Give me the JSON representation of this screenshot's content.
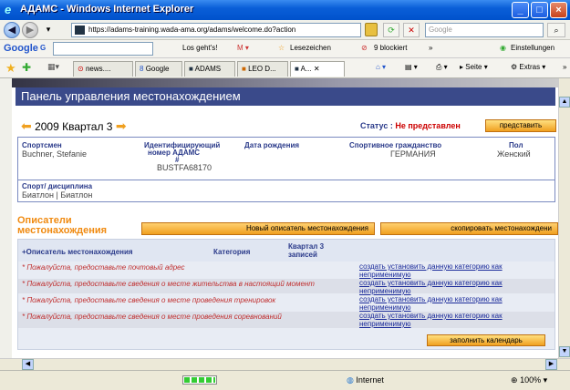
{
  "window": {
    "title": "АДАМС - Windows Internet Explorer"
  },
  "address": {
    "url": "https://adams-training.wada-ama.org/adams/welcome.do?action",
    "search_placeholder": "Google"
  },
  "google_toolbar": {
    "logo": "Google",
    "g_label": "G",
    "goto": "Los geht's!",
    "bookmarks": "Lesezeichen",
    "blocked": "9 blockiert",
    "settings": "Einstellungen"
  },
  "tabs": [
    {
      "label": "news...."
    },
    {
      "label": "Google"
    },
    {
      "label": "ADAMS"
    },
    {
      "label": "LEO D..."
    },
    {
      "label": "A..."
    }
  ],
  "tab_tools": {
    "page": "Seite",
    "extras": "Extras"
  },
  "panel": {
    "title": "Панель управления местонахождением"
  },
  "quarter": {
    "label": "2009 Квартал 3"
  },
  "status": {
    "label": "Статус :",
    "value": "Не представлен",
    "submit": "представить"
  },
  "athlete": {
    "athlete_hdr": "Спортсмен",
    "athlete_val": "Buchner, Stefanie",
    "id_hdr_1": "Идентифицирующий",
    "id_hdr_2": "номер АДАМС",
    "id_hdr_3": "#",
    "id_val": "BUSTFA68170",
    "dob_hdr": "Дата рождения",
    "citizenship_hdr": "Спортивное гражданство",
    "citizenship_val": "ГЕРМАНИЯ",
    "gender_hdr": "Пол",
    "gender_val": "Женский"
  },
  "sport": {
    "hdr": "Спорт/ дисциплина",
    "val": "Биатлон | Биатлон"
  },
  "descriptors": {
    "title_1": "Описатели",
    "title_2": "местонахождения",
    "new_btn": "Новый описатель местонахождения",
    "copy_btn": "скопировать местонахождени",
    "col_descriptor": "+Описатель местонахождения",
    "col_category": "Категория",
    "col_quarter_1": "Квартал 3",
    "col_quarter_2": "записей",
    "rows": [
      {
        "msg": "* Пожалуйста, предоставьте почтовый адрес",
        "link": "создать установить данную категорию как неприменимую"
      },
      {
        "msg": "* Пожалуйста, предоставьте сведения о месте жительства в настоящий момент",
        "link": "создать установить данную категорию как неприменимую"
      },
      {
        "msg": "* Пожалуйста, предоставьте сведения о месте проведения тренировок",
        "link": "создать установить данную категорию как неприменимую"
      },
      {
        "msg": "* Пожалуйста, предоставьте сведения о месте проведения соревнований",
        "link": "создать установить данную категорию как неприменимую"
      }
    ],
    "calendar_btn": "заполнить календарь"
  },
  "statusbar": {
    "zone": "Internet",
    "zoom": "100%"
  }
}
